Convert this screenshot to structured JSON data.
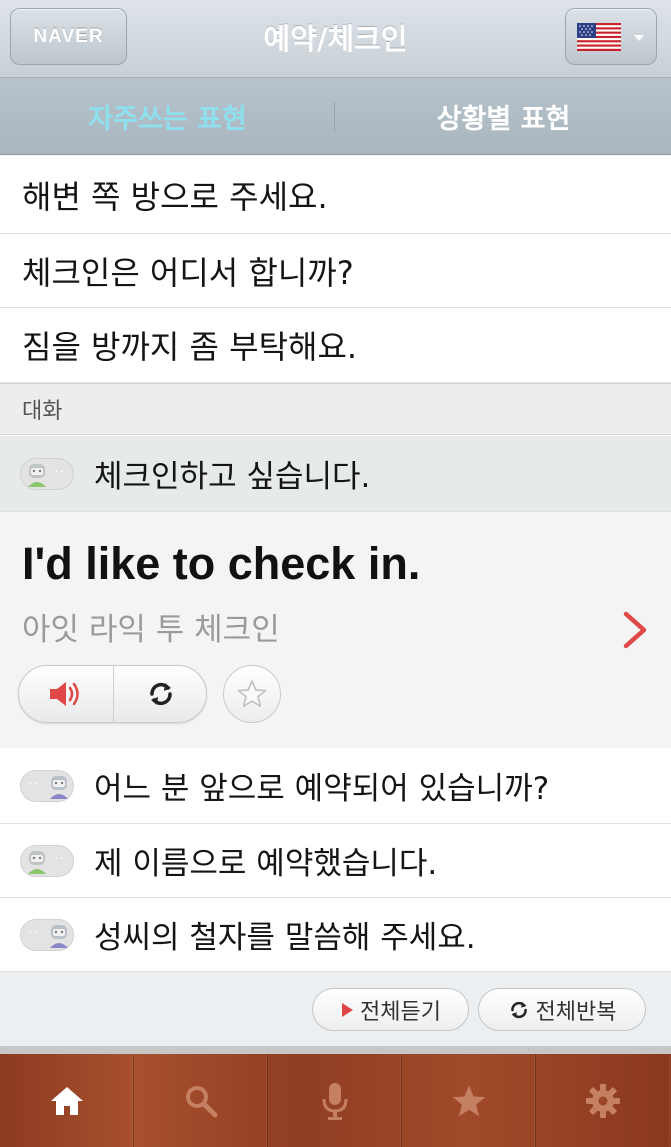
{
  "header": {
    "left_button": "NAVER",
    "title": "예약/체크인",
    "lang_flag": "us-flag-icon"
  },
  "tabs": [
    {
      "label": "자주쓰는 표현",
      "active": true
    },
    {
      "label": "상황별 표현",
      "active": false
    }
  ],
  "phrases": [
    "해변 쪽 방으로 주세요.",
    "체크인은 어디서 합니까?",
    "짐을 방까지 좀 부탁해요."
  ],
  "section_label": "대화",
  "dialogue": [
    {
      "text": "체크인하고 싶습니다.",
      "speaker": "guest"
    },
    {
      "text": "어느 분 앞으로 예약되어 있습니까?",
      "speaker": "staff"
    },
    {
      "text": "제 이름으로 예약했습니다.",
      "speaker": "guest"
    },
    {
      "text": "성씨의 철자를 말씀해 주세요.",
      "speaker": "staff"
    }
  ],
  "selected": {
    "english": "I'd like to check in.",
    "pronunciation": "아잇 라익 투 체크인"
  },
  "actions": {
    "play_all": "전체듣기",
    "repeat_all": "전체반복"
  },
  "tabbar": [
    "home-icon",
    "search-icon",
    "mic-icon",
    "star-icon",
    "gear-icon"
  ],
  "colors": {
    "active_tab": "#8fe0ef",
    "accent_red": "#e04848",
    "tabbar_wood": "#9a4526"
  }
}
